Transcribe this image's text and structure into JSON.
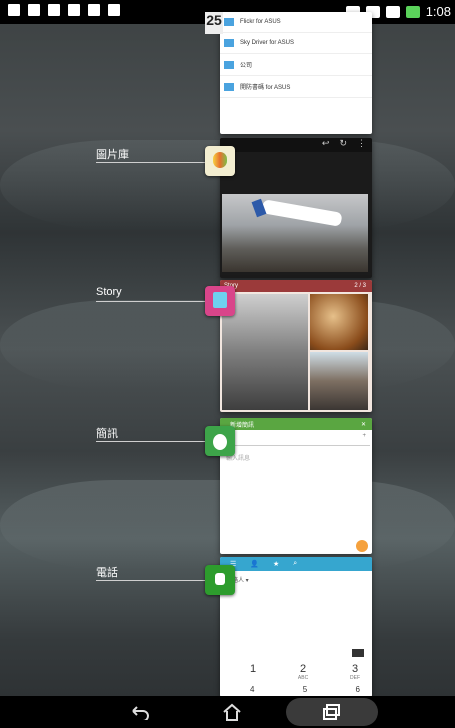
{
  "status_bar": {
    "time": "1:08"
  },
  "recent_apps": [
    {
      "label": "圖片庫"
    },
    {
      "label": "Story"
    },
    {
      "label": "簡訊"
    },
    {
      "label": "電話"
    }
  ],
  "top_card": {
    "tab_number": "25",
    "items": [
      "Flickr for ASUS",
      "Sky Driver for ASUS",
      "公司",
      "開防書碼 for ASUS"
    ]
  },
  "gallery_card": {
    "actions": [
      "↩",
      "↻",
      "⋮"
    ]
  },
  "story_card": {
    "title": "Story",
    "pager": "2 / 3"
  },
  "messaging_card": {
    "title": "新增簡訊",
    "hint": "輸入訊息",
    "add": "+",
    "close": "✕"
  },
  "dialer_card": {
    "header_icons": [
      "☰",
      "👤",
      "★",
      "⌕"
    ],
    "subtitle": "連絡人 ▾",
    "keys_row1": [
      "1",
      "2",
      "3"
    ],
    "keys_row1_sub": [
      "",
      "ABC",
      "DEF"
    ],
    "keys_row2": [
      "4",
      "5",
      "6"
    ]
  },
  "nav": {
    "back": "back-icon",
    "home": "home-icon",
    "recents": "recents-icon"
  }
}
